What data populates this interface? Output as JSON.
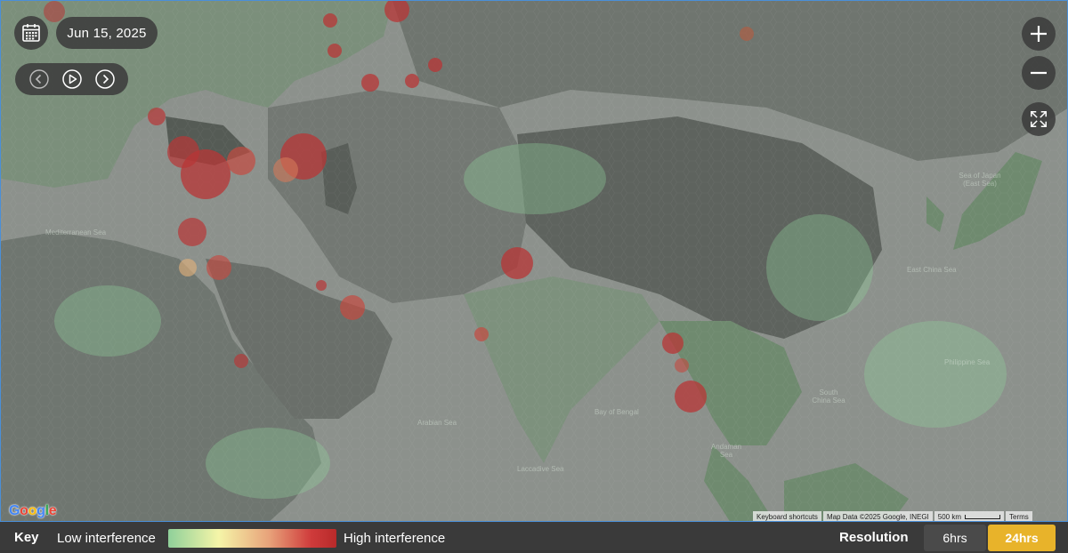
{
  "header": {
    "date": "Jun 15, 2025"
  },
  "map_labels": [
    {
      "text": "Mediterranean Sea"
    },
    {
      "text": "Arabian Sea"
    },
    {
      "text": "Bay of Bengal"
    },
    {
      "text": "Laccadive Sea"
    },
    {
      "text": "Andaman Sea"
    },
    {
      "text": "South China Sea"
    },
    {
      "text": "Philippine Sea"
    },
    {
      "text": "East China Sea"
    },
    {
      "text": "Sea of Japan (East Sea)"
    }
  ],
  "attribution": {
    "logo": "Google",
    "shortcuts": "Keyboard shortcuts",
    "map_data": "Map Data ©2025 Google, INEGI",
    "scale": "500 km",
    "terms": "Terms"
  },
  "legend": {
    "title": "Key",
    "low": "Low interference",
    "high": "High interference",
    "low_color": "#8fd09a",
    "mid_color": "#f5f5a8",
    "high_color": "#cf3b3b"
  },
  "resolution": {
    "title": "Resolution",
    "options": [
      "6hrs",
      "24hrs"
    ],
    "selected": "24hrs",
    "active_color": "#e8b32a"
  },
  "icons": {
    "calendar": "calendar-icon",
    "previous": "chevron-left-icon",
    "play": "play-icon",
    "next": "chevron-right-icon",
    "zoom_in": "plus-icon",
    "zoom_out": "minus-icon",
    "fullscreen": "fullscreen-icon"
  }
}
